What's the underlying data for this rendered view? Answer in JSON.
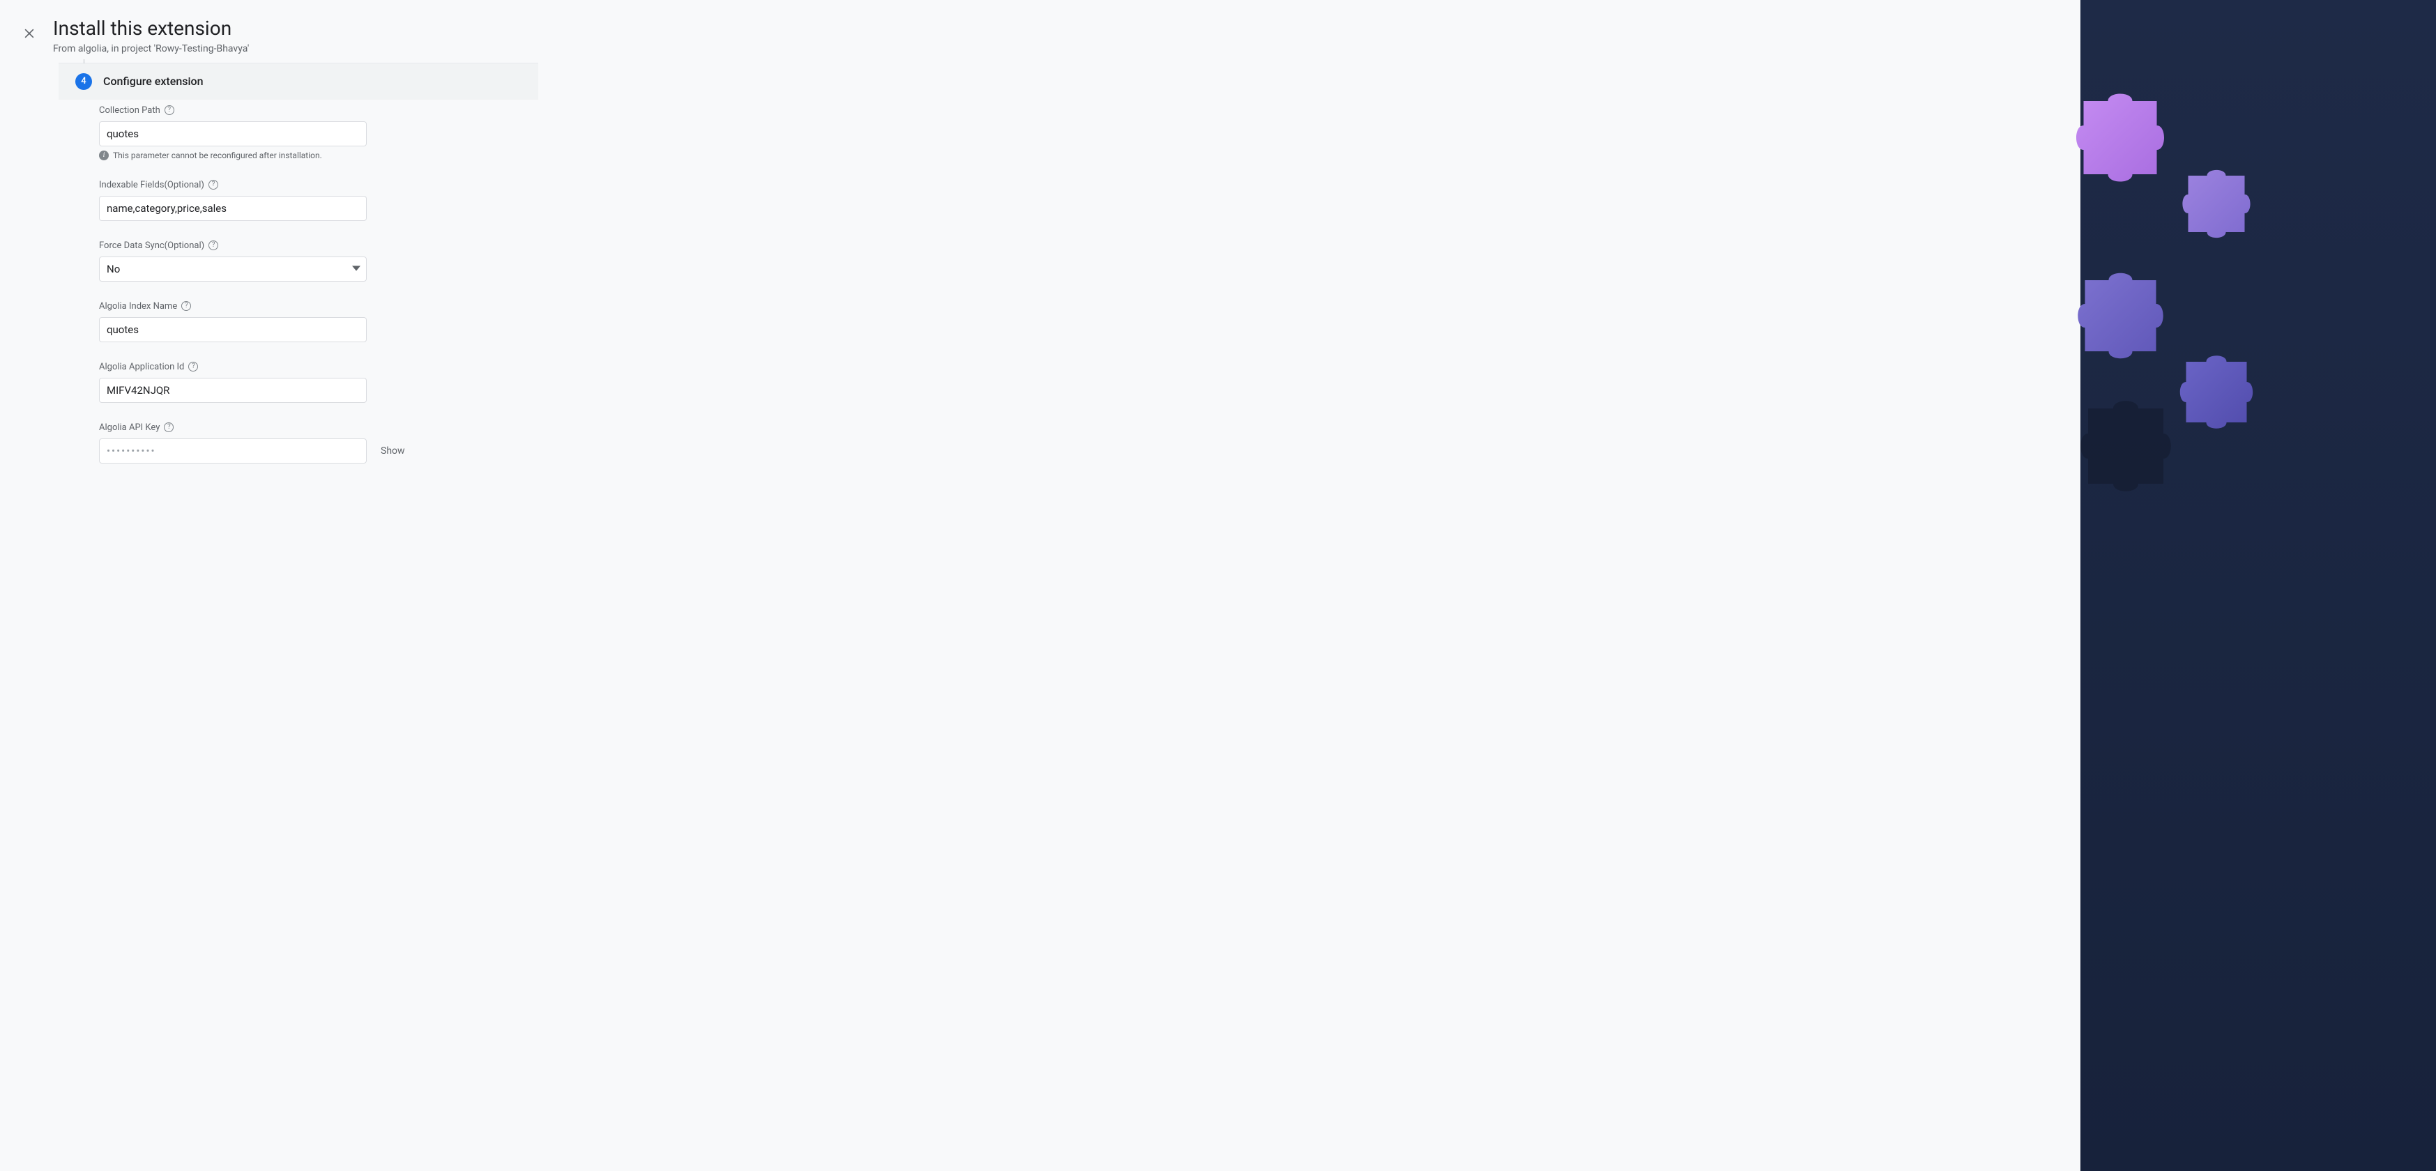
{
  "header": {
    "title": "Install this extension",
    "subtitle": "From algolia, in project 'Rowy-Testing-Bhavya'"
  },
  "step": {
    "number": "4",
    "title": "Configure extension"
  },
  "fields": {
    "collection_path": {
      "label": "Collection Path",
      "value": "quotes",
      "helper": "This parameter cannot be reconfigured after installation."
    },
    "indexable_fields": {
      "label": "Indexable Fields(Optional)",
      "value": "name,category,price,sales"
    },
    "force_data_sync": {
      "label": "Force Data Sync(Optional)",
      "value": "No"
    },
    "algolia_index_name": {
      "label": "Algolia Index Name",
      "value": "quotes"
    },
    "algolia_app_id": {
      "label": "Algolia Application Id",
      "value": "MIFV42NJQR"
    },
    "algolia_api_key": {
      "label": "Algolia API Key",
      "value": "••••••••••",
      "show_label": "Show"
    }
  }
}
